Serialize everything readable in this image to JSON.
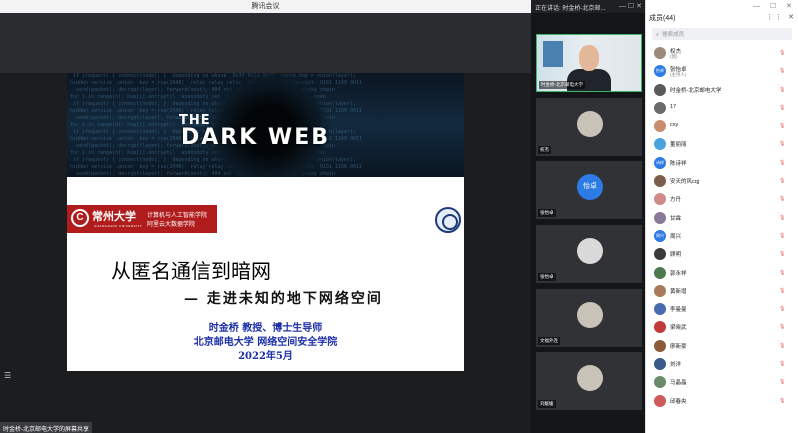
{
  "window": {
    "title": "腾讯会议"
  },
  "speaker_bar": {
    "text": "正在讲话: 时金桥-北京邮...",
    "controls": "— ☐ ✕"
  },
  "share": {
    "label": "时金桥-北京邮电大学的屏幕共享"
  },
  "slide": {
    "banner_line1": "THE",
    "banner_line2": "DARK WEB",
    "university_seal": "C",
    "university_name": "常州大学",
    "university_name_en": "CHANGZHOU UNIVERSITY",
    "dept_line1": "计算机与人工智能学院",
    "dept_line2": "阿里云大数据学院",
    "title": "从匿名通信到暗网",
    "subtitle": "— 走进未知的地下网络空间",
    "author": "时金桥  教授、博士生导师",
    "org": "北京邮电大学  网络空间安全学院",
    "date": "2022年5月"
  },
  "video_tiles": [
    {
      "name": "时金桥-北京邮电大学",
      "type": "camera",
      "avatar_text": ""
    },
    {
      "name": "权杰",
      "type": "photo",
      "avatar_text": ""
    },
    {
      "name": "张怡卓",
      "type": "initials",
      "avatar_text": "怡卓"
    },
    {
      "name": "张怡卓",
      "type": "default",
      "avatar_text": ""
    },
    {
      "name": "文福外连",
      "type": "photo",
      "avatar_text": ""
    },
    {
      "name": "刘媛媛",
      "type": "photo",
      "avatar_text": ""
    }
  ],
  "members_panel": {
    "header": "成员(44)",
    "header_controls": "⋮⋮ ✕",
    "window_controls": "— ☐ ✕",
    "search_placeholder": "搜索成员",
    "members": [
      {
        "name": "权杰",
        "role": "(我)",
        "avatar_text": "",
        "color": "#9b8a7a"
      },
      {
        "name": "张怡卓",
        "role": "(主持人)",
        "avatar_text": "怡卓",
        "color": "#2d7be5"
      },
      {
        "name": "时金桥-北京邮电大学",
        "role": "",
        "avatar_text": "",
        "color": "#5a5a5a"
      },
      {
        "name": "17",
        "role": "",
        "avatar_text": "",
        "color": "#6b6b6b"
      },
      {
        "name": "cxy",
        "role": "",
        "avatar_text": "",
        "color": "#c98c6f"
      },
      {
        "name": "董丽丽",
        "role": "",
        "avatar_text": "",
        "color": "#4aa3df"
      },
      {
        "name": "陈诗祥",
        "role": "",
        "avatar_text": "诗祥",
        "color": "#2d7be5"
      },
      {
        "name": "安天的风cqj",
        "role": "",
        "avatar_text": "",
        "color": "#7c5c4a"
      },
      {
        "name": "方丹",
        "role": "",
        "avatar_text": "",
        "color": "#d08a8a"
      },
      {
        "name": "甘霖",
        "role": "",
        "avatar_text": "",
        "color": "#8a7a9a"
      },
      {
        "name": "周兴",
        "role": "",
        "avatar_text": "周兴",
        "color": "#2d7be5"
      },
      {
        "name": "顾明",
        "role": "",
        "avatar_text": "",
        "color": "#3a3a3a"
      },
      {
        "name": "郭永祥",
        "role": "",
        "avatar_text": "",
        "color": "#4c7a4c"
      },
      {
        "name": "黄新增",
        "role": "",
        "avatar_text": "",
        "color": "#a87a5a"
      },
      {
        "name": "李曼曼",
        "role": "",
        "avatar_text": "",
        "color": "#4a6ab0"
      },
      {
        "name": "梁晓武",
        "role": "",
        "avatar_text": "",
        "color": "#c23a3a"
      },
      {
        "name": "廖新豪",
        "role": "",
        "avatar_text": "",
        "color": "#8a5a3a"
      },
      {
        "name": "刘洋",
        "role": "",
        "avatar_text": "",
        "color": "#3a5a8a"
      },
      {
        "name": "马晶晶",
        "role": "",
        "avatar_text": "",
        "color": "#6a8a6a"
      },
      {
        "name": "邱春央",
        "role": "",
        "avatar_text": "",
        "color": "#d05a5a"
      }
    ]
  }
}
